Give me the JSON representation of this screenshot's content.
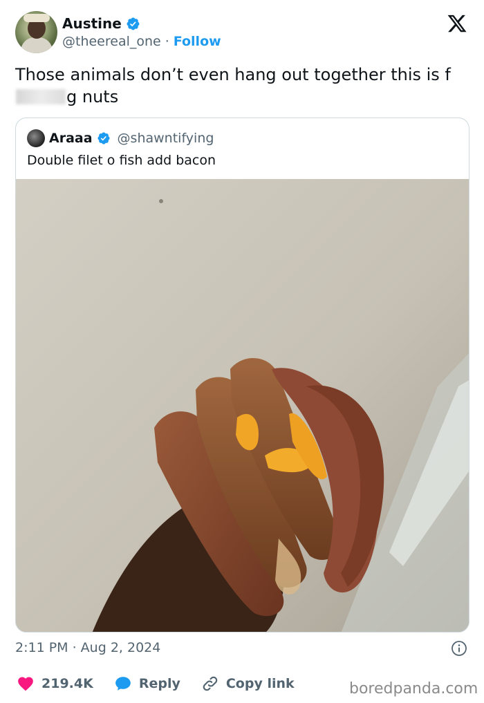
{
  "author": {
    "display_name": "Austine",
    "handle": "@theereal_one",
    "separator": "·",
    "follow_label": "Follow"
  },
  "tweet": {
    "text_before": "Those animals don’t even hang out together this is f",
    "text_after": "g nuts"
  },
  "quoted": {
    "display_name": "Araaa",
    "handle": "@shawntifying",
    "text": "Double filet o fish add bacon"
  },
  "meta": {
    "timestamp": "2:11 PM · Aug 2, 2024"
  },
  "actions": {
    "likes": "219.4K",
    "reply_label": "Reply",
    "copy_link_label": "Copy link"
  },
  "credit": "boredpanda.com",
  "colors": {
    "accent": "#1d9bf0",
    "like": "#f91880",
    "text": "#0f1419",
    "muted": "#536471"
  },
  "icons": {
    "verified": "verified-badge-icon",
    "logo": "x-logo-icon",
    "info": "info-icon",
    "like": "heart-icon",
    "reply": "speech-bubble-icon",
    "copy": "link-icon"
  }
}
